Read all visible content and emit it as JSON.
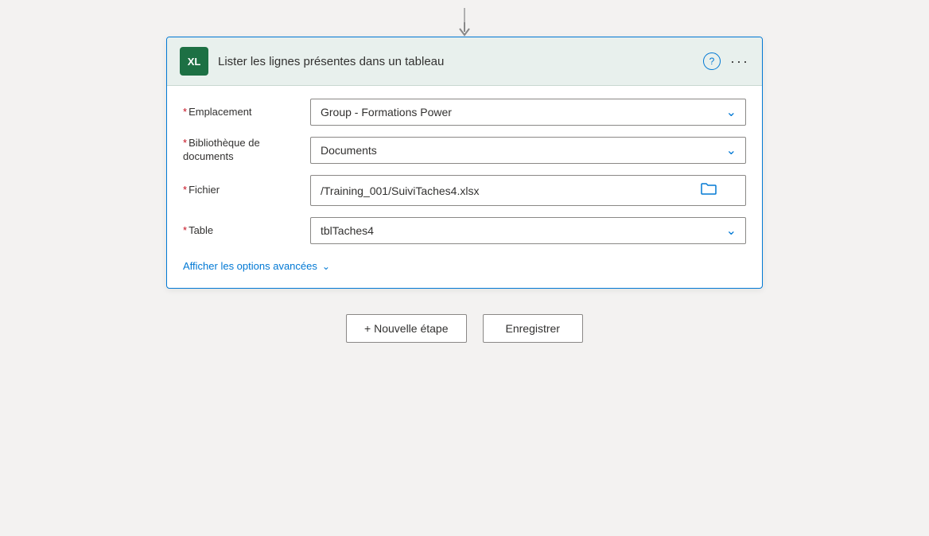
{
  "connector": {
    "arrow_visible": true
  },
  "card": {
    "title": "Lister les lignes présentes dans un tableau",
    "help_label": "?",
    "more_label": "···",
    "excel_label": "XL"
  },
  "fields": {
    "emplacement": {
      "label": "Emplacement",
      "required": "*",
      "value": "Group - Formations Power"
    },
    "bibliotheque": {
      "label": "Bibliothèque de documents",
      "required": "*",
      "value": "Documents"
    },
    "fichier": {
      "label": "Fichier",
      "required": "*",
      "value": "/Training_001/SuiviTaches4.xlsx"
    },
    "table": {
      "label": "Table",
      "required": "*",
      "value": "tblTaches4"
    },
    "advanced_label": "Afficher les options avancées"
  },
  "actions": {
    "new_step": "+ Nouvelle étape",
    "save": "Enregistrer"
  }
}
